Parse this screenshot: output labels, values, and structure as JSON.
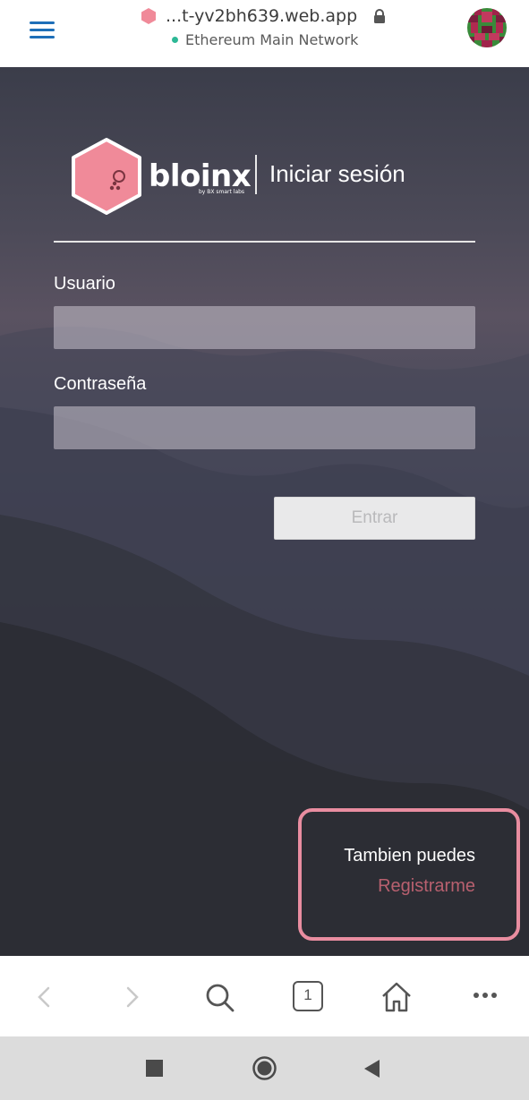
{
  "browser": {
    "url": "...t-yv2bh639.web.app",
    "network": "Ethereum Main Network",
    "icons": {
      "menu": "hamburger-icon",
      "site": "hexagon-site-icon",
      "lock": "lock-icon",
      "account": "identicon-avatar"
    }
  },
  "brand": {
    "name": "bloinx",
    "tagline": "by BX smart labs",
    "logo_color": "#f08a99"
  },
  "login": {
    "title": "Iniciar sesión",
    "username_label": "Usuario",
    "username_value": "",
    "password_label": "Contraseña",
    "password_value": "",
    "submit_label": "Entrar"
  },
  "register": {
    "prompt": "Tambien puedes",
    "link_label": "Registrarme",
    "highlight_color": "#e98da0"
  },
  "bottom_nav": {
    "items": [
      "back-icon",
      "forward-icon",
      "search-icon",
      "tabs-icon",
      "home-icon",
      "more-icon"
    ],
    "tab_count": "1"
  },
  "system_nav": {
    "items": [
      "recents-icon",
      "home-circle-icon",
      "back-triangle-icon"
    ]
  }
}
